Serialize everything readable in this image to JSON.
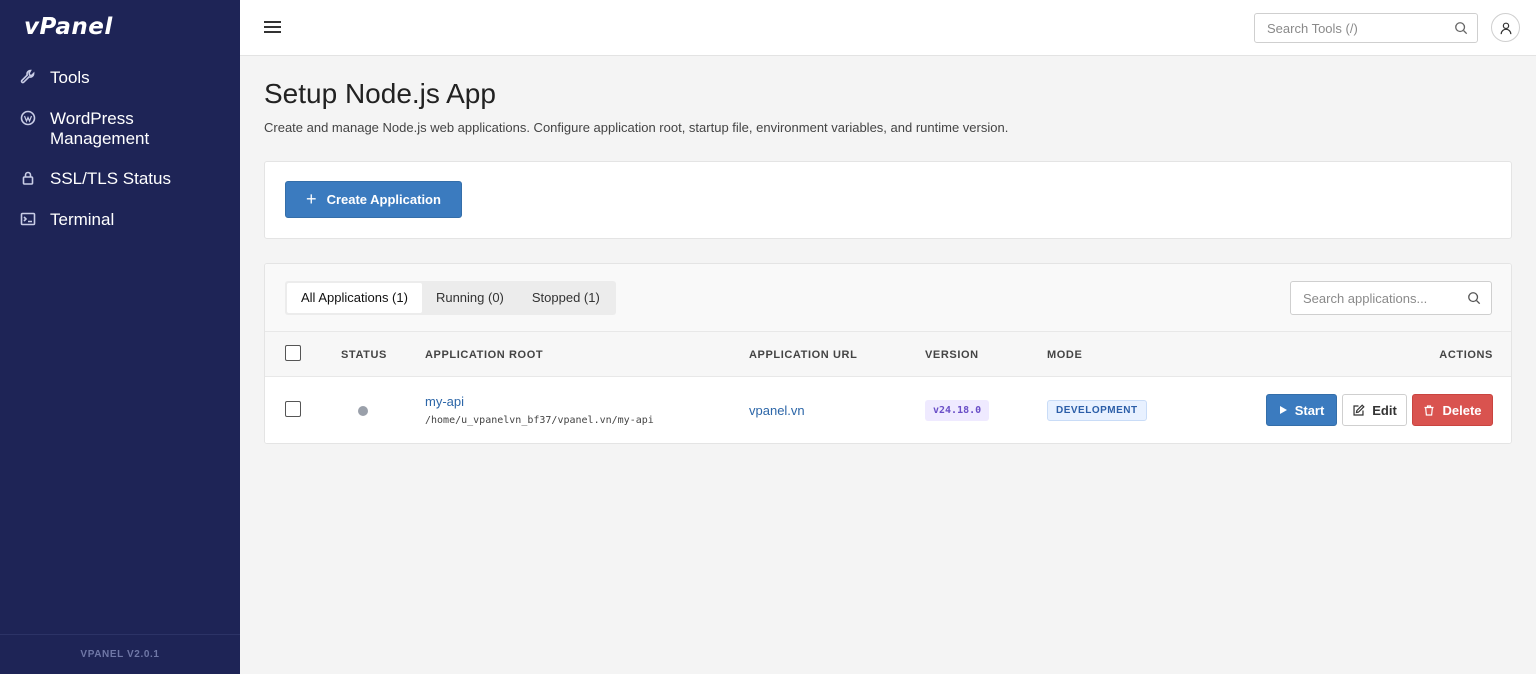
{
  "sidebar": {
    "logo": "vPanel",
    "items": [
      {
        "label": "Tools",
        "icon": "wrench-icon"
      },
      {
        "label": "WordPress Management",
        "icon": "wordpress-icon"
      },
      {
        "label": "SSL/TLS Status",
        "icon": "lock-icon"
      },
      {
        "label": "Terminal",
        "icon": "terminal-icon"
      }
    ],
    "footer": "VPANEL V2.0.1"
  },
  "topbar": {
    "search_placeholder": "Search Tools (/)"
  },
  "page": {
    "title": "Setup Node.js App",
    "subtitle": "Create and manage Node.js web applications. Configure application root, startup file, environment variables, and runtime version.",
    "create_button": "Create Application"
  },
  "apps": {
    "tabs": [
      {
        "label": "All Applications (1)",
        "active": true
      },
      {
        "label": "Running (0)",
        "active": false
      },
      {
        "label": "Stopped (1)",
        "active": false
      }
    ],
    "search_placeholder": "Search applications...",
    "columns": {
      "status": "STATUS",
      "root": "APPLICATION ROOT",
      "url": "APPLICATION URL",
      "version": "VERSION",
      "mode": "MODE",
      "actions": "ACTIONS"
    },
    "rows": [
      {
        "status": "stopped",
        "name": "my-api",
        "path": "/home/u_vpanelvn_bf37/vpanel.vn/my-api",
        "url": "vpanel.vn",
        "version": "v24.18.0",
        "mode": "DEVELOPMENT",
        "actions": {
          "start": "Start",
          "edit": "Edit",
          "delete": "Delete"
        }
      }
    ]
  },
  "colors": {
    "sidebar_bg": "#1e2456",
    "primary": "#3b7bbf",
    "danger": "#d9534f",
    "link": "#2c66a8"
  }
}
